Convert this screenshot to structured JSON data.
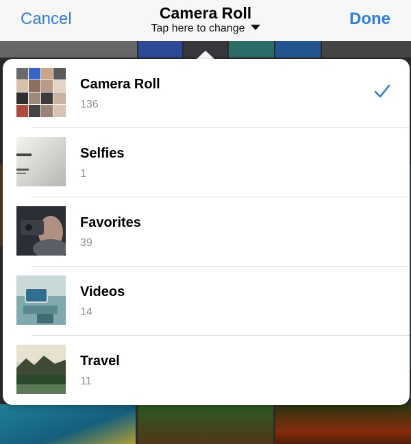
{
  "navbar": {
    "cancel_label": "Cancel",
    "done_label": "Done",
    "title": "Camera Roll",
    "subtitle": "Tap here to change"
  },
  "albums": [
    {
      "name": "Camera Roll",
      "count": "136",
      "selected": true,
      "thumb": "photo-grid-collage"
    },
    {
      "name": "Selfies",
      "count": "1",
      "selected": false,
      "thumb": "ios10-screen-photo"
    },
    {
      "name": "Favorites",
      "count": "39",
      "selected": false,
      "thumb": "person-with-phone-photo"
    },
    {
      "name": "Videos",
      "count": "14",
      "selected": false,
      "thumb": "phone-on-glass-photo"
    },
    {
      "name": "Travel",
      "count": "11",
      "selected": false,
      "thumb": "mountain-lake-photo"
    }
  ],
  "icons": {
    "selected_mark": "checkmark-icon",
    "subtitle_caret": "caret-down-icon"
  },
  "colors": {
    "accent": "#2f7fe0",
    "secondary_text": "#8e8e93"
  }
}
